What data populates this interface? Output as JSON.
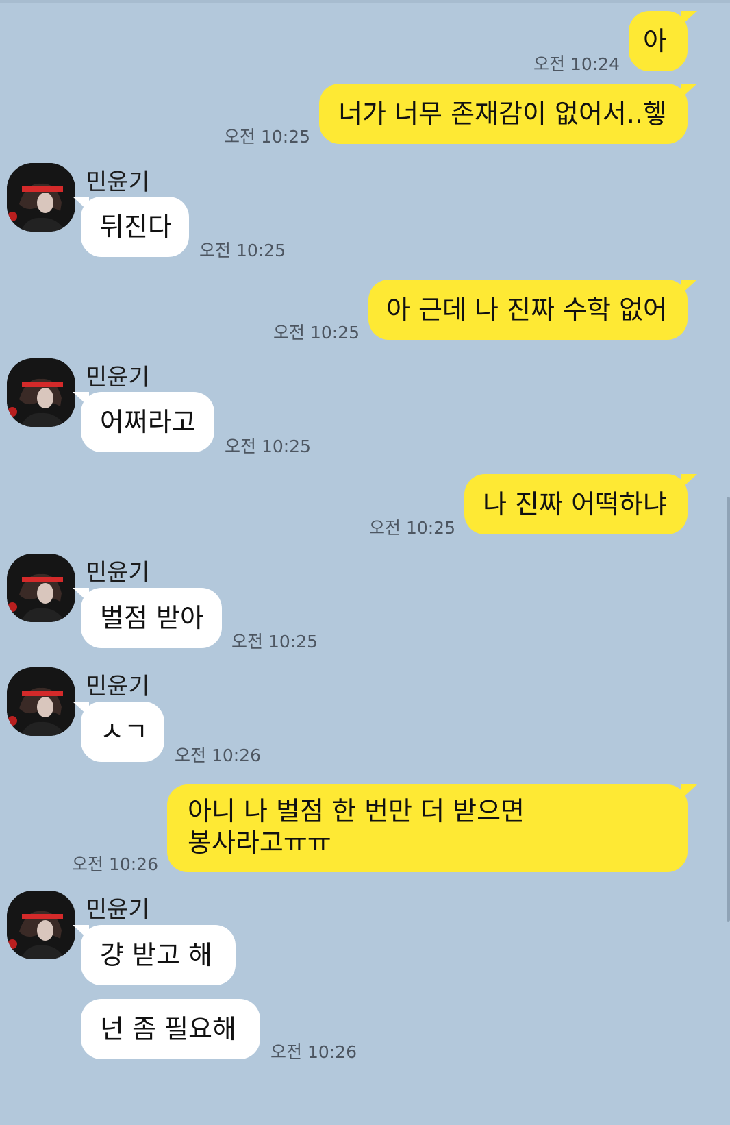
{
  "contact": {
    "name": "민윤기"
  },
  "messages": [
    {
      "text": "아",
      "time": "오전 10:24"
    },
    {
      "text": "너가 너무 존재감이 없어서..헿",
      "time": "오전 10:25"
    },
    {
      "text": "뒤진다",
      "time": "오전 10:25"
    },
    {
      "text": "아 근데 나 진짜 수학 없어",
      "time": "오전 10:25"
    },
    {
      "text": "어쩌라고",
      "time": "오전 10:25"
    },
    {
      "text": "나 진짜 어떡하냐",
      "time": "오전 10:25"
    },
    {
      "text": "벌점 받아",
      "time": "오전 10:25"
    },
    {
      "text": "ㅅㄱ",
      "time": "오전 10:26"
    },
    {
      "text": "아니 나 벌점 한 번만 더 받으면 봉사라고ㅠㅠ",
      "time": "오전 10:26"
    },
    {
      "text": "걍 받고 해"
    },
    {
      "text": "넌 좀 필요해",
      "time": "오전 10:26"
    }
  ],
  "colors": {
    "background": "#b3c8db",
    "my_bubble": "#fee934",
    "their_bubble": "#ffffff",
    "avatar_accent": "#d42a2a"
  },
  "icons": {
    "avatar": "profile-photo-icon"
  }
}
